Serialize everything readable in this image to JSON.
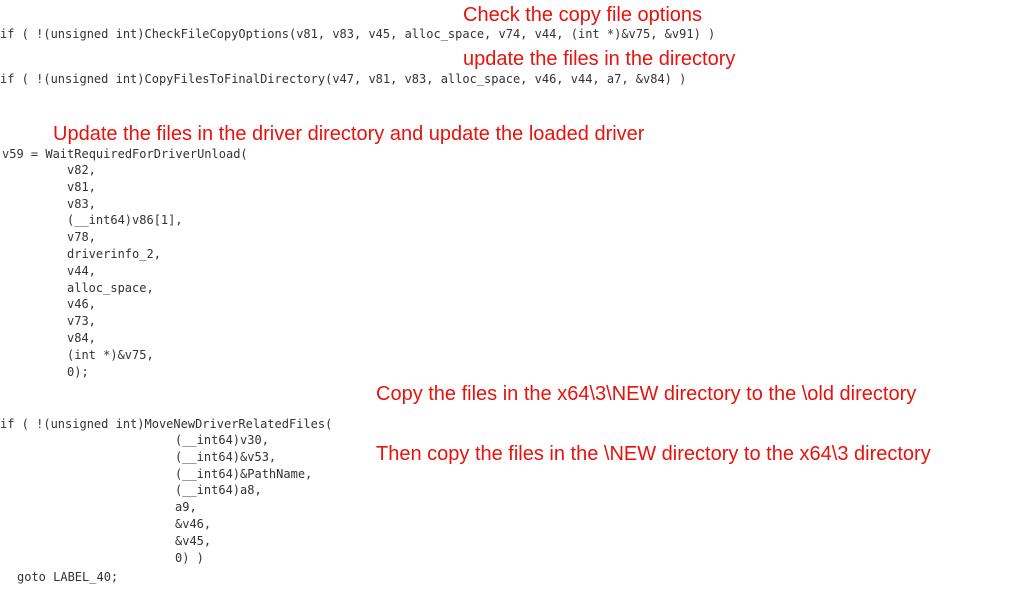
{
  "annotations": {
    "a1": "Check the copy file options",
    "a2": "update the files in the directory",
    "a3": "Update the files in the driver directory and update the loaded driver",
    "a4": "Copy the files in the x64\\3\\NEW directory to the \\old directory",
    "a5": "Then copy the files in the \\NEW directory to the x64\\3 directory"
  },
  "code": {
    "l1": "if ( !(unsigned int)CheckFileCopyOptions(v81, v83, v45, alloc_space, v74, v44, (int *)&v75, &v91) )",
    "l2": "if ( !(unsigned int)CopyFilesToFinalDirectory(v47, v81, v83, alloc_space, v46, v44, a7, &v84) )",
    "l3": "v59 = WaitRequiredForDriverUnload(",
    "wait_args": [
      "v82,",
      "v81,",
      "v83,",
      "(__int64)v86[1],",
      "v78,",
      "driverinfo_2,",
      "v44,",
      "alloc_space,",
      "v46,",
      "v73,",
      "v84,",
      "(int *)&v75,",
      "0);"
    ],
    "l4": "if ( !(unsigned int)MoveNewDriverRelatedFiles(",
    "move_args": [
      "(__int64)v30,",
      "(__int64)&v53,",
      "(__int64)&PathName,",
      "(__int64)a8,",
      "a9,",
      "&v46,",
      "&v45,",
      "0) )"
    ],
    "l5": "goto LABEL_40;"
  }
}
